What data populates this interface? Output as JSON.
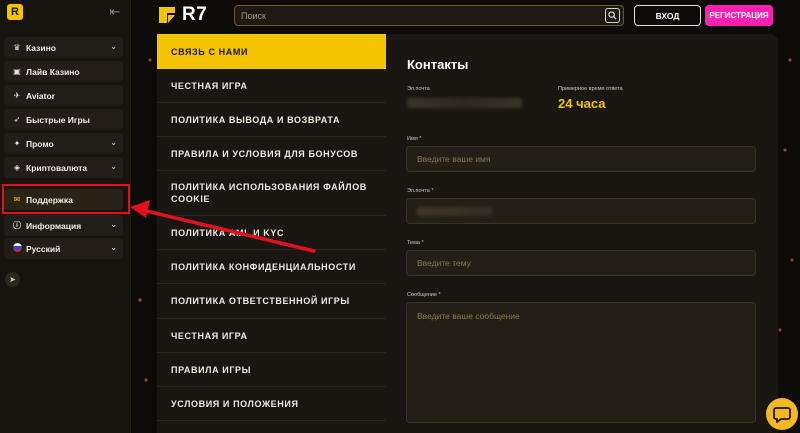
{
  "sidebar": {
    "items": [
      {
        "label": "Казино",
        "icon": "casino-icon",
        "has_chevron": true
      },
      {
        "label": "Лайв Казино",
        "icon": "live-casino-icon",
        "has_chevron": false
      },
      {
        "label": "Aviator",
        "icon": "plane-icon",
        "has_chevron": false
      },
      {
        "label": "Быстрые Игры",
        "icon": "rocket-icon",
        "has_chevron": false
      },
      {
        "label": "Промо",
        "icon": "megaphone-icon",
        "has_chevron": true
      },
      {
        "label": "Криптовалюта",
        "icon": "crypto-icon",
        "has_chevron": true
      },
      {
        "label": "Поддержка",
        "icon": "support-icon",
        "has_chevron": false
      },
      {
        "label": "Информация",
        "icon": "info-icon",
        "has_chevron": true
      },
      {
        "label": "Русский",
        "icon": "russia-flag-icon",
        "has_chevron": true
      }
    ]
  },
  "header": {
    "logo_text": "R7",
    "search_placeholder": "Поиск",
    "login_label": "ВХОД",
    "register_label": "РЕГИСТРАЦИЯ"
  },
  "menu": {
    "items": [
      "СВЯЗЬ С НАМИ",
      "ЧЕСТНАЯ ИГРА",
      "ПОЛИТИКА ВЫВОДА И ВОЗВРАТА",
      "ПРАВИЛА И УСЛОВИЯ ДЛЯ БОНУСОВ",
      "ПОЛИТИКА ИСПОЛЬЗОВАНИЯ ФАЙЛОВ COOKIE",
      "ПОЛИТИКА AML И KYC",
      "ПОЛИТИКА КОНФИДЕНЦИАЛЬНОСТИ",
      "ПОЛИТИКА ОТВЕТСТВЕННОЙ ИГРЫ",
      "ЧЕСТНАЯ ИГРА",
      "ПРАВИЛА ИГРЫ",
      "УСЛОВИЯ И ПОЛОЖЕНИЯ"
    ],
    "active_index": 0
  },
  "contacts": {
    "title": "Контакты",
    "email_label": "Эл.почта",
    "response_label": "Примерное время ответа",
    "response_value": "24 часа",
    "name_label": "Имя *",
    "name_placeholder": "Введите ваше имя",
    "email_field_label": "Эл.почта *",
    "subject_label": "Тема *",
    "subject_placeholder": "Введите тему",
    "message_label": "Сообщение *",
    "message_placeholder": "Введите ваше сообщение"
  },
  "colors": {
    "accent": "#f4c400",
    "register": "#ff1fb3",
    "highlight": "#e0121a"
  }
}
